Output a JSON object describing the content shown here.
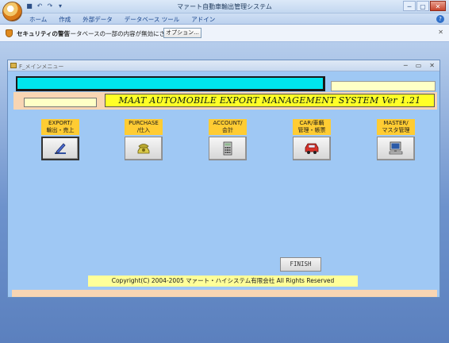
{
  "window": {
    "title": "マァート自動車輸出管理システム",
    "controls": [
      "─",
      "▢",
      "✕"
    ]
  },
  "ribbon": {
    "tabs": [
      "ホーム",
      "作成",
      "外部データ",
      "データベース ツール",
      "アドイン"
    ],
    "help_icon": "help-icon"
  },
  "security_bar": {
    "title": "セキュリティの警告",
    "message": "データベースの一部の内容が無効にされました",
    "options_button": "オプション..."
  },
  "form": {
    "title": "F_メインメニュー",
    "system_title": "MAAT  AUTOMOBILE  EXPORT MANAGEMENT SYSTEM  Ver 1.21",
    "modules": [
      {
        "line1": "EXPORT/",
        "line2": "輸出・売上",
        "icon": "pencil-icon"
      },
      {
        "line1": "PURCHASE",
        "line2": "/仕入",
        "icon": "telephone-icon"
      },
      {
        "line1": "ACCOUNT/",
        "line2": "会計",
        "icon": "calculator-icon"
      },
      {
        "line1": "CAR/車輌",
        "line2": "管理・帳票",
        "icon": "car-icon"
      },
      {
        "line1": "MASTER/",
        "line2": "マスタ管理",
        "icon": "computer-icon"
      }
    ],
    "finish_button": "FINISH",
    "copyright": "Copyright(C) 2004-2005 マァート・ハイシステム有限会社 All Rights Reserved"
  },
  "colors": {
    "form_background": "#9fc8f4",
    "title_bar_cyan": "#00e5ee",
    "label_orange": "#ffcc33",
    "peach_band": "#f8d5b3",
    "title_yellow": "#ffff26"
  }
}
